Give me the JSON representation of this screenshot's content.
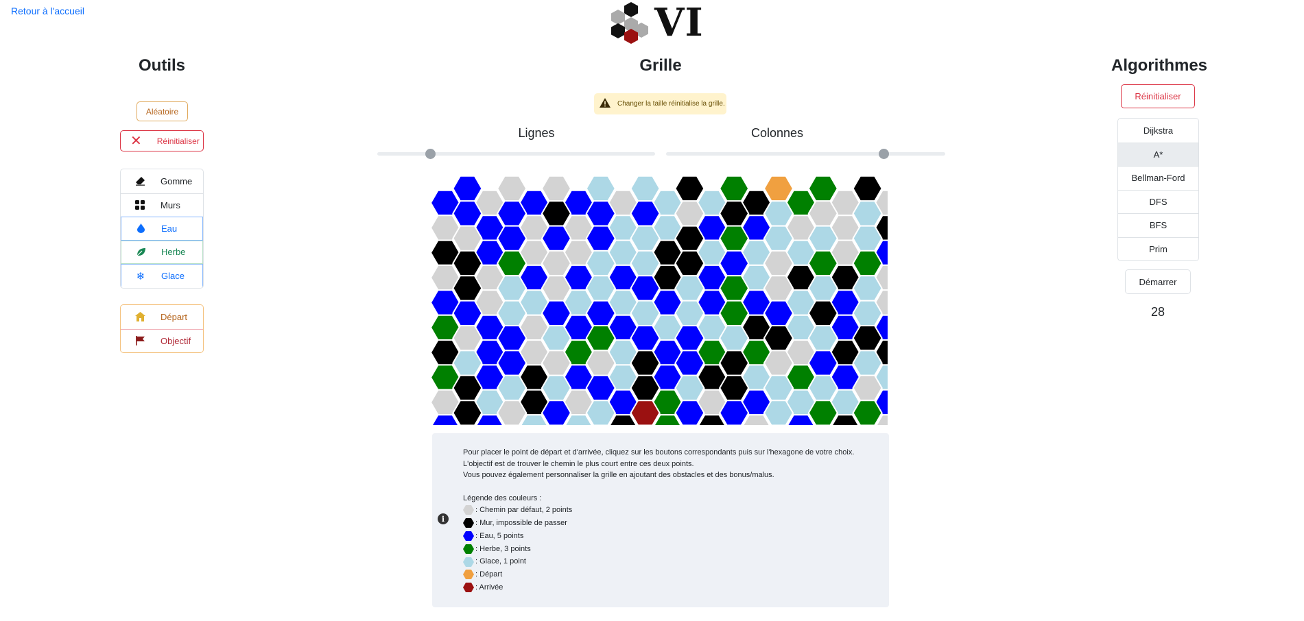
{
  "nav": {
    "home_link": "Retour à l'accueil"
  },
  "logo": {
    "text": "VI"
  },
  "tools": {
    "title": "Outils",
    "random_label": "Aléatoire",
    "reset_label": "Réinitialiser",
    "items": [
      {
        "label": "Gomme",
        "icon": "eraser-icon"
      },
      {
        "label": "Murs",
        "icon": "blocks-icon"
      },
      {
        "label": "Eau",
        "icon": "droplet-icon",
        "color": "#0d6efd"
      },
      {
        "label": "Herbe",
        "icon": "leaf-icon",
        "color": "#198754"
      },
      {
        "label": "Glace",
        "icon": "snowflake-icon",
        "color": "#0d6efd"
      }
    ],
    "points": [
      {
        "label": "Départ",
        "icon": "house-icon",
        "color": "#b5651d"
      },
      {
        "label": "Objectif",
        "icon": "flag-icon",
        "color": "#b02a37"
      }
    ]
  },
  "grid": {
    "title": "Grille",
    "warning": "Changer la taille réinitialise la grille.",
    "rows_label": "Lignes",
    "cols_label": "Colonnes",
    "rows_slider_fraction": 0.19,
    "cols_slider_fraction": 0.78,
    "colors": {
      "G": "#d3d3d3",
      "K": "#000000",
      "B": "#0000ff",
      "V": "#008000",
      "C": "#add8e6",
      "O": "#f0a040",
      "R": "#9b1111"
    },
    "cells": [
      "BGGCCKVOVK",
      "BBKBBGKCGCV",
      "GBBBCKVCCCK",
      "KVGCCKBGVVG",
      "KCGCBCVGCCG",
      "BCBBCCVBKCK",
      "GBCVBBCKCKV",
      "CBGGKBKGBCK",
      "KCCBKCKCCGB",
      "KGBCRBBCVVC",
      "VCCKBGBKGGC"
    ],
    "rows": [
      "BGBBGCCKVGGVCCB",
      "GBGGCCBBGGKCGGC",
      "KBGGCKCCCGBGCCB",
      "GGBBBKBCKKGKCGK",
      "BGCCCBBBCBGKGBV",
      "VBGBBCCKCBBGCGV",
      "KBGVCBVVGKKVCCC",
      "VBKBCBKCVBCKGKB",
      "GCKGBVGBCCBGGKG",
      "BBCCKVKGBKGBVCC",
      "KGKVCRGGCCVGGKV"
    ]
  },
  "info": {
    "lines": [
      "Pour placer le point de départ et d'arrivée, cliquez sur les boutons correspondants puis sur l'hexagone de votre choix.",
      "L'objectif est de trouver le chemin le plus court entre ces deux points.",
      "Vous pouvez également personnaliser la grille en ajoutant des obstacles et des bonus/malus."
    ],
    "legend_title": "Légende des couleurs :",
    "legend": [
      {
        "color": "#d3d3d3",
        "text": ": Chemin par défaut, 2 points"
      },
      {
        "color": "#000000",
        "text": ": Mur, impossible de passer"
      },
      {
        "color": "#0000ff",
        "text": ": Eau, 5 points"
      },
      {
        "color": "#008000",
        "text": ": Herbe, 3 points"
      },
      {
        "color": "#add8e6",
        "text": ": Glace, 1 point"
      },
      {
        "color": "#f0a040",
        "text": ": Départ"
      },
      {
        "color": "#9b1111",
        "text": ": Arrivée"
      }
    ]
  },
  "algorithms": {
    "title": "Algorithmes",
    "reset_label": "Réinitialiser",
    "items": [
      "Dijkstra",
      "A*",
      "Bellman-Ford",
      "DFS",
      "BFS",
      "Prim"
    ],
    "selected": "A*",
    "start_label": "Démarrer",
    "result": "28"
  }
}
